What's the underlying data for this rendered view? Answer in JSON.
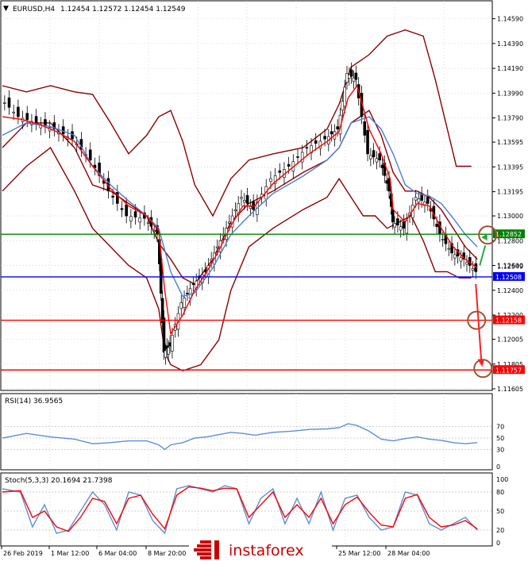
{
  "header": {
    "symbol": "EURUSD,H4",
    "ohlc": "1.12454 1.12572 1.12454 1.12549"
  },
  "colors": {
    "background": "#ffffff",
    "grid": "#c0c0c0",
    "candles": "#000000",
    "bollinger": "#8b0000",
    "fast_ma": "#ff0000",
    "slow_ma": "#4a7fd4",
    "level_green": "#008000",
    "level_blue": "#0000ff",
    "level_red": "#ff0000",
    "rsi_line": "#5b8fd6",
    "stoch_main": "#5b8fd6",
    "stoch_signal": "#ff0000",
    "marker_circle": "#a0522d",
    "arrow_up": "#22aa44",
    "arrow_down": "#ff2020",
    "watermark_bg": "#ffffff",
    "watermark_stripes": "#cc0000"
  },
  "chart_data": [
    {
      "type": "line",
      "name": "main",
      "title": "EURUSD,H4",
      "ylim": [
        1.11605,
        1.1469
      ],
      "y_ticks": [
        "1.14590",
        "1.14390",
        "1.14190",
        "1.13990",
        "1.13790",
        "1.13595",
        "1.13395",
        "1.13195",
        "1.13000",
        "1.12800",
        "1.12600",
        "1.12400",
        "1.12200",
        "1.12005",
        "1.11805",
        "1.11605"
      ],
      "levels": [
        {
          "value": 1.12852,
          "label": "1.12852",
          "color": "#008000"
        },
        {
          "value": 1.12508,
          "label": "1.12508",
          "color": "#0000ff"
        },
        {
          "value": 1.12158,
          "label": "1.12158",
          "color": "#ff0000"
        },
        {
          "value": 1.11757,
          "label": "1.11757",
          "color": "#ff0000"
        }
      ],
      "last_price_label": "1.12549",
      "x_range": [
        0,
        100
      ],
      "close_series": [
        [
          0,
          1.1395
        ],
        [
          3,
          1.138
        ],
        [
          6,
          1.1375
        ],
        [
          9,
          1.137
        ],
        [
          12,
          1.1362
        ],
        [
          15,
          1.1345
        ],
        [
          18,
          1.132
        ],
        [
          21,
          1.13
        ],
        [
          24,
          1.1298
        ],
        [
          26,
          1.1285
        ],
        [
          27,
          1.119
        ],
        [
          28,
          1.1195
        ],
        [
          30,
          1.123
        ],
        [
          32,
          1.1245
        ],
        [
          34,
          1.1255
        ],
        [
          36,
          1.1275
        ],
        [
          38,
          1.1295
        ],
        [
          40,
          1.1315
        ],
        [
          42,
          1.1305
        ],
        [
          45,
          1.133
        ],
        [
          48,
          1.134
        ],
        [
          51,
          1.1355
        ],
        [
          54,
          1.1362
        ],
        [
          56,
          1.137
        ],
        [
          57.5,
          1.1415
        ],
        [
          59,
          1.141
        ],
        [
          61,
          1.135
        ],
        [
          63,
          1.1345
        ],
        [
          64.5,
          1.132
        ],
        [
          65,
          1.1295
        ],
        [
          67,
          1.129
        ],
        [
          69,
          1.1315
        ],
        [
          71,
          1.131
        ],
        [
          73,
          1.1285
        ],
        [
          75,
          1.127
        ],
        [
          77,
          1.1265
        ],
        [
          79,
          1.1255
        ]
      ],
      "bollinger_upper": [
        [
          0,
          1.1405
        ],
        [
          4,
          1.14
        ],
        [
          8,
          1.1405
        ],
        [
          12,
          1.14
        ],
        [
          15,
          1.1398
        ],
        [
          18,
          1.1375
        ],
        [
          21,
          1.135
        ],
        [
          24,
          1.1365
        ],
        [
          26,
          1.138
        ],
        [
          28,
          1.1385
        ],
        [
          30,
          1.136
        ],
        [
          32,
          1.1325
        ],
        [
          35,
          1.13
        ],
        [
          38,
          1.133
        ],
        [
          41,
          1.1345
        ],
        [
          45,
          1.135
        ],
        [
          50,
          1.1355
        ],
        [
          54,
          1.137
        ],
        [
          56,
          1.139
        ],
        [
          58,
          1.142
        ],
        [
          61,
          1.143
        ],
        [
          64,
          1.1445
        ],
        [
          67,
          1.145
        ],
        [
          70,
          1.1445
        ],
        [
          72,
          1.141
        ],
        [
          74,
          1.137
        ],
        [
          75.5,
          1.134
        ],
        [
          78,
          1.134
        ]
      ],
      "bollinger_middle": [
        [
          0,
          1.1355
        ],
        [
          4,
          1.1375
        ],
        [
          8,
          1.1375
        ],
        [
          12,
          1.1355
        ],
        [
          15,
          1.1325
        ],
        [
          18,
          1.132
        ],
        [
          21,
          1.131
        ],
        [
          24,
          1.13
        ],
        [
          26,
          1.1278
        ],
        [
          28,
          1.1265
        ],
        [
          30,
          1.125
        ],
        [
          32,
          1.1245
        ],
        [
          35,
          1.1265
        ],
        [
          38,
          1.1295
        ],
        [
          41,
          1.131
        ],
        [
          45,
          1.132
        ],
        [
          50,
          1.1335
        ],
        [
          54,
          1.1345
        ],
        [
          56,
          1.1355
        ],
        [
          58,
          1.1375
        ],
        [
          61,
          1.1385
        ],
        [
          63,
          1.1365
        ],
        [
          65,
          1.1335
        ],
        [
          67,
          1.132
        ],
        [
          69,
          1.132
        ],
        [
          71,
          1.1315
        ],
        [
          73,
          1.1305
        ],
        [
          75,
          1.129
        ],
        [
          77,
          1.1275
        ],
        [
          79,
          1.1265
        ]
      ],
      "bollinger_lower": [
        [
          0,
          1.132
        ],
        [
          4,
          1.134
        ],
        [
          8,
          1.1355
        ],
        [
          12,
          1.132
        ],
        [
          15,
          1.129
        ],
        [
          18,
          1.1275
        ],
        [
          21,
          1.126
        ],
        [
          24,
          1.125
        ],
        [
          26,
          1.1225
        ],
        [
          27,
          1.119
        ],
        [
          28,
          1.118
        ],
        [
          30,
          1.1175
        ],
        [
          33,
          1.118
        ],
        [
          36,
          1.12
        ],
        [
          38,
          1.124
        ],
        [
          41,
          1.1275
        ],
        [
          45,
          1.129
        ],
        [
          50,
          1.1305
        ],
        [
          54,
          1.1315
        ],
        [
          56,
          1.133
        ],
        [
          58,
          1.1315
        ],
        [
          60,
          1.13
        ],
        [
          62,
          1.13
        ],
        [
          64,
          1.129
        ],
        [
          66,
          1.1295
        ],
        [
          68,
          1.13
        ],
        [
          70,
          1.128
        ],
        [
          72,
          1.1255
        ],
        [
          74,
          1.1255
        ],
        [
          76,
          1.125
        ],
        [
          78,
          1.125
        ]
      ],
      "fast_ma": [
        [
          0,
          1.138
        ],
        [
          3,
          1.1378
        ],
        [
          6,
          1.1374
        ],
        [
          9,
          1.1368
        ],
        [
          12,
          1.136
        ],
        [
          15,
          1.134
        ],
        [
          18,
          1.1322
        ],
        [
          21,
          1.1308
        ],
        [
          24,
          1.13
        ],
        [
          26,
          1.1288
        ],
        [
          27,
          1.124
        ],
        [
          28,
          1.1205
        ],
        [
          30,
          1.122
        ],
        [
          32,
          1.124
        ],
        [
          34,
          1.1255
        ],
        [
          36,
          1.1272
        ],
        [
          38,
          1.1292
        ],
        [
          40,
          1.1308
        ],
        [
          42,
          1.1308
        ],
        [
          45,
          1.1326
        ],
        [
          48,
          1.1338
        ],
        [
          51,
          1.135
        ],
        [
          54,
          1.136
        ],
        [
          56,
          1.1368
        ],
        [
          57.5,
          1.1395
        ],
        [
          59,
          1.1405
        ],
        [
          61,
          1.137
        ],
        [
          63,
          1.135
        ],
        [
          64.5,
          1.133
        ],
        [
          65,
          1.1305
        ],
        [
          67,
          1.1295
        ],
        [
          69,
          1.131
        ],
        [
          71,
          1.1308
        ],
        [
          73,
          1.129
        ],
        [
          75,
          1.1275
        ],
        [
          77,
          1.1265
        ],
        [
          79,
          1.1258
        ]
      ],
      "slow_ma": [
        [
          0,
          1.1365
        ],
        [
          4,
          1.1375
        ],
        [
          8,
          1.1372
        ],
        [
          12,
          1.1365
        ],
        [
          15,
          1.134
        ],
        [
          18,
          1.1325
        ],
        [
          21,
          1.1312
        ],
        [
          24,
          1.13
        ],
        [
          26,
          1.129
        ],
        [
          28,
          1.1255
        ],
        [
          30,
          1.1235
        ],
        [
          32,
          1.1238
        ],
        [
          35,
          1.1258
        ],
        [
          38,
          1.1285
        ],
        [
          41,
          1.13
        ],
        [
          45,
          1.1318
        ],
        [
          50,
          1.1332
        ],
        [
          54,
          1.1345
        ],
        [
          56,
          1.1355
        ],
        [
          58,
          1.1375
        ],
        [
          61,
          1.138
        ],
        [
          63,
          1.137
        ],
        [
          65,
          1.135
        ],
        [
          67,
          1.1325
        ],
        [
          69,
          1.1318
        ],
        [
          71,
          1.1316
        ],
        [
          73,
          1.131
        ],
        [
          75,
          1.1298
        ],
        [
          77,
          1.1285
        ],
        [
          79,
          1.1275
        ]
      ]
    },
    {
      "type": "line",
      "name": "rsi",
      "title": "RSI(14) 36.9565",
      "ylim": [
        0,
        100
      ],
      "y_ticks": [
        "70",
        "50",
        "30",
        "0"
      ],
      "levels": [
        70,
        50,
        30
      ],
      "rsi_values": [
        [
          0,
          50
        ],
        [
          4,
          58
        ],
        [
          8,
          52
        ],
        [
          12,
          48
        ],
        [
          15,
          40
        ],
        [
          18,
          42
        ],
        [
          21,
          45
        ],
        [
          24,
          45
        ],
        [
          26,
          38
        ],
        [
          27,
          30
        ],
        [
          28,
          38
        ],
        [
          30,
          42
        ],
        [
          32,
          50
        ],
        [
          34,
          52
        ],
        [
          36,
          56
        ],
        [
          38,
          60
        ],
        [
          40,
          58
        ],
        [
          42,
          55
        ],
        [
          45,
          60
        ],
        [
          48,
          62
        ],
        [
          51,
          65
        ],
        [
          54,
          66
        ],
        [
          56,
          68
        ],
        [
          57.5,
          75
        ],
        [
          59,
          72
        ],
        [
          61,
          62
        ],
        [
          63,
          48
        ],
        [
          65,
          45
        ],
        [
          67,
          49
        ],
        [
          69,
          52
        ],
        [
          71,
          48
        ],
        [
          73,
          46
        ],
        [
          75,
          42
        ],
        [
          77,
          40
        ],
        [
          79,
          42
        ]
      ]
    },
    {
      "type": "line",
      "name": "stochastic",
      "title": "Stoch(5,3,3) 20.1694 21.7398",
      "ylim": [
        0,
        100
      ],
      "y_ticks": [
        "100",
        "80",
        "50",
        "20",
        "0"
      ],
      "levels": [
        80,
        50,
        20
      ],
      "x_labels": [
        "26 Feb 2019",
        "1 Mar 12:00",
        "6 Mar 04:00",
        "8 Mar 20:00",
        "25 Mar 12:00",
        "28 Mar 04:00"
      ],
      "stoch_main": [
        [
          0,
          85
        ],
        [
          3,
          80
        ],
        [
          5,
          25
        ],
        [
          7,
          60
        ],
        [
          9,
          15
        ],
        [
          11,
          20
        ],
        [
          13,
          50
        ],
        [
          15,
          80
        ],
        [
          17,
          60
        ],
        [
          19,
          20
        ],
        [
          21,
          80
        ],
        [
          23,
          75
        ],
        [
          25,
          35
        ],
        [
          27,
          15
        ],
        [
          29,
          85
        ],
        [
          31,
          90
        ],
        [
          33,
          85
        ],
        [
          35,
          80
        ],
        [
          37,
          90
        ],
        [
          39,
          85
        ],
        [
          41,
          30
        ],
        [
          43,
          70
        ],
        [
          45,
          85
        ],
        [
          47,
          30
        ],
        [
          49,
          70
        ],
        [
          51,
          30
        ],
        [
          53,
          80
        ],
        [
          55,
          20
        ],
        [
          57,
          70
        ],
        [
          59,
          75
        ],
        [
          61,
          40
        ],
        [
          63,
          20
        ],
        [
          65,
          25
        ],
        [
          67,
          80
        ],
        [
          69,
          75
        ],
        [
          71,
          30
        ],
        [
          73,
          20
        ],
        [
          75,
          30
        ],
        [
          77,
          40
        ],
        [
          79,
          20
        ]
      ],
      "stoch_signal": [
        [
          0,
          80
        ],
        [
          3,
          82
        ],
        [
          5,
          40
        ],
        [
          7,
          50
        ],
        [
          9,
          25
        ],
        [
          11,
          18
        ],
        [
          13,
          40
        ],
        [
          15,
          70
        ],
        [
          17,
          65
        ],
        [
          19,
          30
        ],
        [
          21,
          70
        ],
        [
          23,
          75
        ],
        [
          25,
          45
        ],
        [
          27,
          22
        ],
        [
          29,
          75
        ],
        [
          31,
          88
        ],
        [
          33,
          86
        ],
        [
          35,
          82
        ],
        [
          37,
          86
        ],
        [
          39,
          85
        ],
        [
          41,
          40
        ],
        [
          43,
          60
        ],
        [
          45,
          80
        ],
        [
          47,
          40
        ],
        [
          49,
          60
        ],
        [
          51,
          40
        ],
        [
          53,
          70
        ],
        [
          55,
          30
        ],
        [
          57,
          60
        ],
        [
          59,
          72
        ],
        [
          61,
          48
        ],
        [
          63,
          28
        ],
        [
          65,
          25
        ],
        [
          67,
          70
        ],
        [
          69,
          76
        ],
        [
          71,
          40
        ],
        [
          73,
          25
        ],
        [
          75,
          28
        ],
        [
          77,
          35
        ],
        [
          79,
          22
        ]
      ]
    }
  ],
  "watermark": {
    "text": "instaforex"
  }
}
